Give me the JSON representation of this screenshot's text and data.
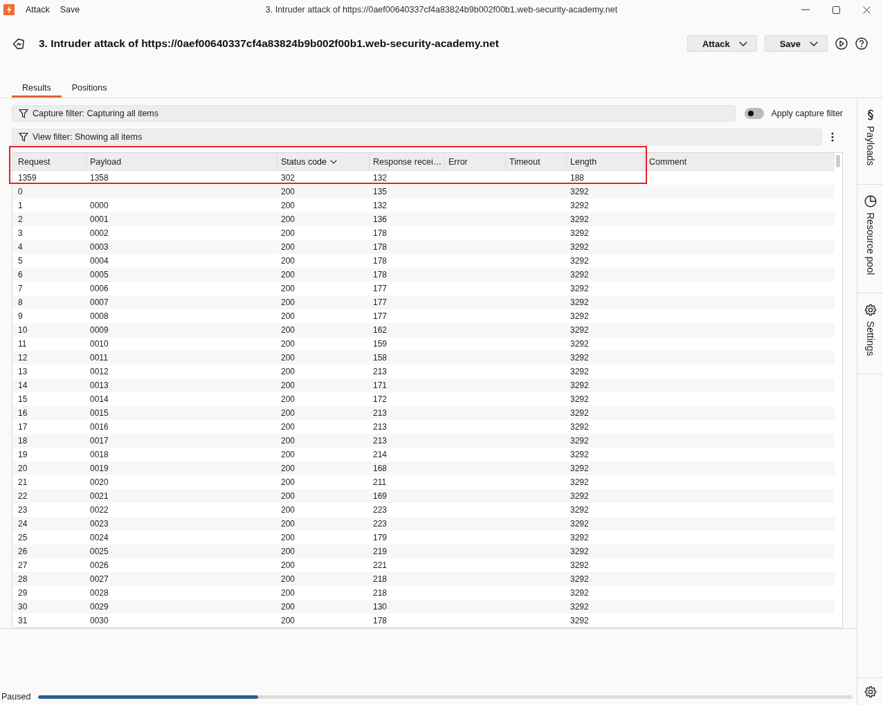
{
  "window": {
    "title": "3. Intruder attack of https://0aef00640337cf4a83824b9b002f00b1.web-security-academy.net",
    "menu": [
      "Attack",
      "Save"
    ]
  },
  "header": {
    "title": "3. Intruder attack of https://0aef00640337cf4a83824b9b002f00b1.web-security-academy.net",
    "buttons": [
      {
        "label": "Attack"
      },
      {
        "label": "Save"
      }
    ]
  },
  "tabs": [
    {
      "label": "Results",
      "selected": true
    },
    {
      "label": "Positions",
      "selected": false
    }
  ],
  "capture_filter": {
    "label": "Capture filter: Capturing all items"
  },
  "apply_capture_filter": {
    "label": "Apply capture filter",
    "on": false
  },
  "view_filter": {
    "label": "View filter: Showing all items"
  },
  "table": {
    "columns": [
      {
        "label": "Request",
        "sorted": false
      },
      {
        "label": "Payload",
        "sorted": false
      },
      {
        "label": "Status code",
        "sorted": true
      },
      {
        "label": "Response recei…",
        "sorted": false
      },
      {
        "label": "Error",
        "sorted": false
      },
      {
        "label": "Timeout",
        "sorted": false
      },
      {
        "label": "Length",
        "sorted": false
      },
      {
        "label": "Comment",
        "sorted": false
      }
    ],
    "rows": [
      {
        "request": "1359",
        "payload": "1358",
        "status_code": "302",
        "response_received": "132",
        "length": "188"
      },
      {
        "request": "0",
        "status_code": "200",
        "response_received": "135",
        "length": "3292"
      },
      {
        "request": "1",
        "payload": "0000",
        "status_code": "200",
        "response_received": "132",
        "length": "3292"
      },
      {
        "request": "2",
        "payload": "0001",
        "status_code": "200",
        "response_received": "136",
        "length": "3292"
      },
      {
        "request": "3",
        "payload": "0002",
        "status_code": "200",
        "response_received": "178",
        "length": "3292"
      },
      {
        "request": "4",
        "payload": "0003",
        "status_code": "200",
        "response_received": "178",
        "length": "3292"
      },
      {
        "request": "5",
        "payload": "0004",
        "status_code": "200",
        "response_received": "178",
        "length": "3292"
      },
      {
        "request": "6",
        "payload": "0005",
        "status_code": "200",
        "response_received": "178",
        "length": "3292"
      },
      {
        "request": "7",
        "payload": "0006",
        "status_code": "200",
        "response_received": "177",
        "length": "3292"
      },
      {
        "request": "8",
        "payload": "0007",
        "status_code": "200",
        "response_received": "177",
        "length": "3292"
      },
      {
        "request": "9",
        "payload": "0008",
        "status_code": "200",
        "response_received": "177",
        "length": "3292"
      },
      {
        "request": "10",
        "payload": "0009",
        "status_code": "200",
        "response_received": "162",
        "length": "3292"
      },
      {
        "request": "11",
        "payload": "0010",
        "status_code": "200",
        "response_received": "159",
        "length": "3292"
      },
      {
        "request": "12",
        "payload": "0011",
        "status_code": "200",
        "response_received": "158",
        "length": "3292"
      },
      {
        "request": "13",
        "payload": "0012",
        "status_code": "200",
        "response_received": "213",
        "length": "3292"
      },
      {
        "request": "14",
        "payload": "0013",
        "status_code": "200",
        "response_received": "171",
        "length": "3292"
      },
      {
        "request": "15",
        "payload": "0014",
        "status_code": "200",
        "response_received": "172",
        "length": "3292"
      },
      {
        "request": "16",
        "payload": "0015",
        "status_code": "200",
        "response_received": "213",
        "length": "3292"
      },
      {
        "request": "17",
        "payload": "0016",
        "status_code": "200",
        "response_received": "213",
        "length": "3292"
      },
      {
        "request": "18",
        "payload": "0017",
        "status_code": "200",
        "response_received": "213",
        "length": "3292"
      },
      {
        "request": "19",
        "payload": "0018",
        "status_code": "200",
        "response_received": "214",
        "length": "3292"
      },
      {
        "request": "20",
        "payload": "0019",
        "status_code": "200",
        "response_received": "168",
        "length": "3292"
      },
      {
        "request": "21",
        "payload": "0020",
        "status_code": "200",
        "response_received": "211",
        "length": "3292"
      },
      {
        "request": "22",
        "payload": "0021",
        "status_code": "200",
        "response_received": "169",
        "length": "3292"
      },
      {
        "request": "23",
        "payload": "0022",
        "status_code": "200",
        "response_received": "223",
        "length": "3292"
      },
      {
        "request": "24",
        "payload": "0023",
        "status_code": "200",
        "response_received": "223",
        "length": "3292"
      },
      {
        "request": "25",
        "payload": "0024",
        "status_code": "200",
        "response_received": "179",
        "length": "3292"
      },
      {
        "request": "26",
        "payload": "0025",
        "status_code": "200",
        "response_received": "219",
        "length": "3292"
      },
      {
        "request": "27",
        "payload": "0026",
        "status_code": "200",
        "response_received": "221",
        "length": "3292"
      },
      {
        "request": "28",
        "payload": "0027",
        "status_code": "200",
        "response_received": "218",
        "length": "3292"
      },
      {
        "request": "29",
        "payload": "0028",
        "status_code": "200",
        "response_received": "218",
        "length": "3292"
      },
      {
        "request": "30",
        "payload": "0029",
        "status_code": "200",
        "response_received": "130",
        "length": "3292"
      },
      {
        "request": "31",
        "payload": "0030",
        "status_code": "200",
        "response_received": "178",
        "length": "3292"
      }
    ]
  },
  "annotation": {
    "kind": "rectangle"
  },
  "sidebar": {
    "items": [
      {
        "label": "Payloads",
        "kind": "payloads"
      },
      {
        "label": "Resource pool",
        "kind": "resource_pool"
      },
      {
        "label": "Settings",
        "kind": "settings"
      }
    ]
  },
  "status_bar": {
    "label": "Paused",
    "level": 0.27
  }
}
